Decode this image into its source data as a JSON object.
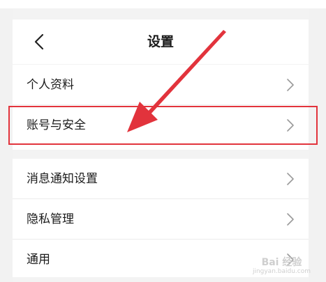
{
  "header": {
    "title": "设置"
  },
  "groups": [
    {
      "items": [
        {
          "label": "个人资料"
        },
        {
          "label": "账号与安全"
        }
      ]
    },
    {
      "items": [
        {
          "label": "消息通知设置"
        },
        {
          "label": "隐私管理"
        },
        {
          "label": "通用"
        }
      ]
    }
  ],
  "highlight": {
    "target": "账号与安全",
    "color": "#e2333c"
  },
  "watermark": {
    "main": "Bai 经验",
    "sub": "jingyan.baidu.com"
  },
  "icons": {
    "back": "chevron-left-icon",
    "item": "chevron-right-icon"
  }
}
